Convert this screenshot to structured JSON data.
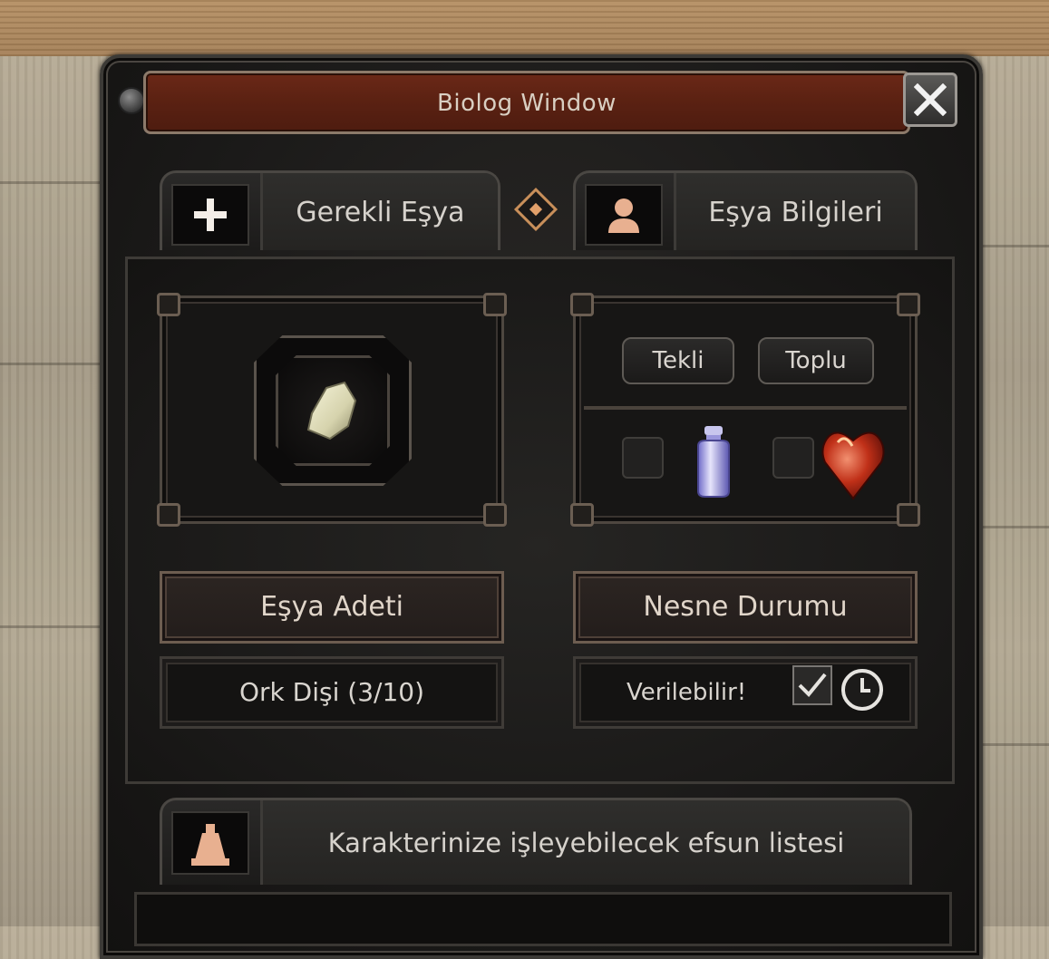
{
  "window": {
    "title": "Biolog Window"
  },
  "tabs": [
    {
      "label": "Gerekli Eşya",
      "icon": "plus-icon"
    },
    {
      "label": "Eşya Bilgileri",
      "icon": "person-icon"
    }
  ],
  "mode_buttons": {
    "single": "Tekli",
    "bulk": "Toplu"
  },
  "required_item": {
    "icon": "bone-fragment-icon"
  },
  "options": [
    {
      "icon": "potion-bottle-icon",
      "checked": false
    },
    {
      "icon": "red-heart-gem-icon",
      "checked": false
    }
  ],
  "item_count": {
    "label": "Eşya Adeti",
    "value": "Ork Dişi (3/10)"
  },
  "item_status": {
    "label": "Nesne Durumu",
    "value": "Verilebilir!",
    "checked": true
  },
  "bonus_section": {
    "label": "Karakterinize işleyebilecek efsun listesi",
    "icon": "flask-icon"
  },
  "colors": {
    "title_bar": "#5a2112",
    "accent": "#e2a06a",
    "panel": "#1b1a19",
    "text": "#d9d5cf"
  }
}
